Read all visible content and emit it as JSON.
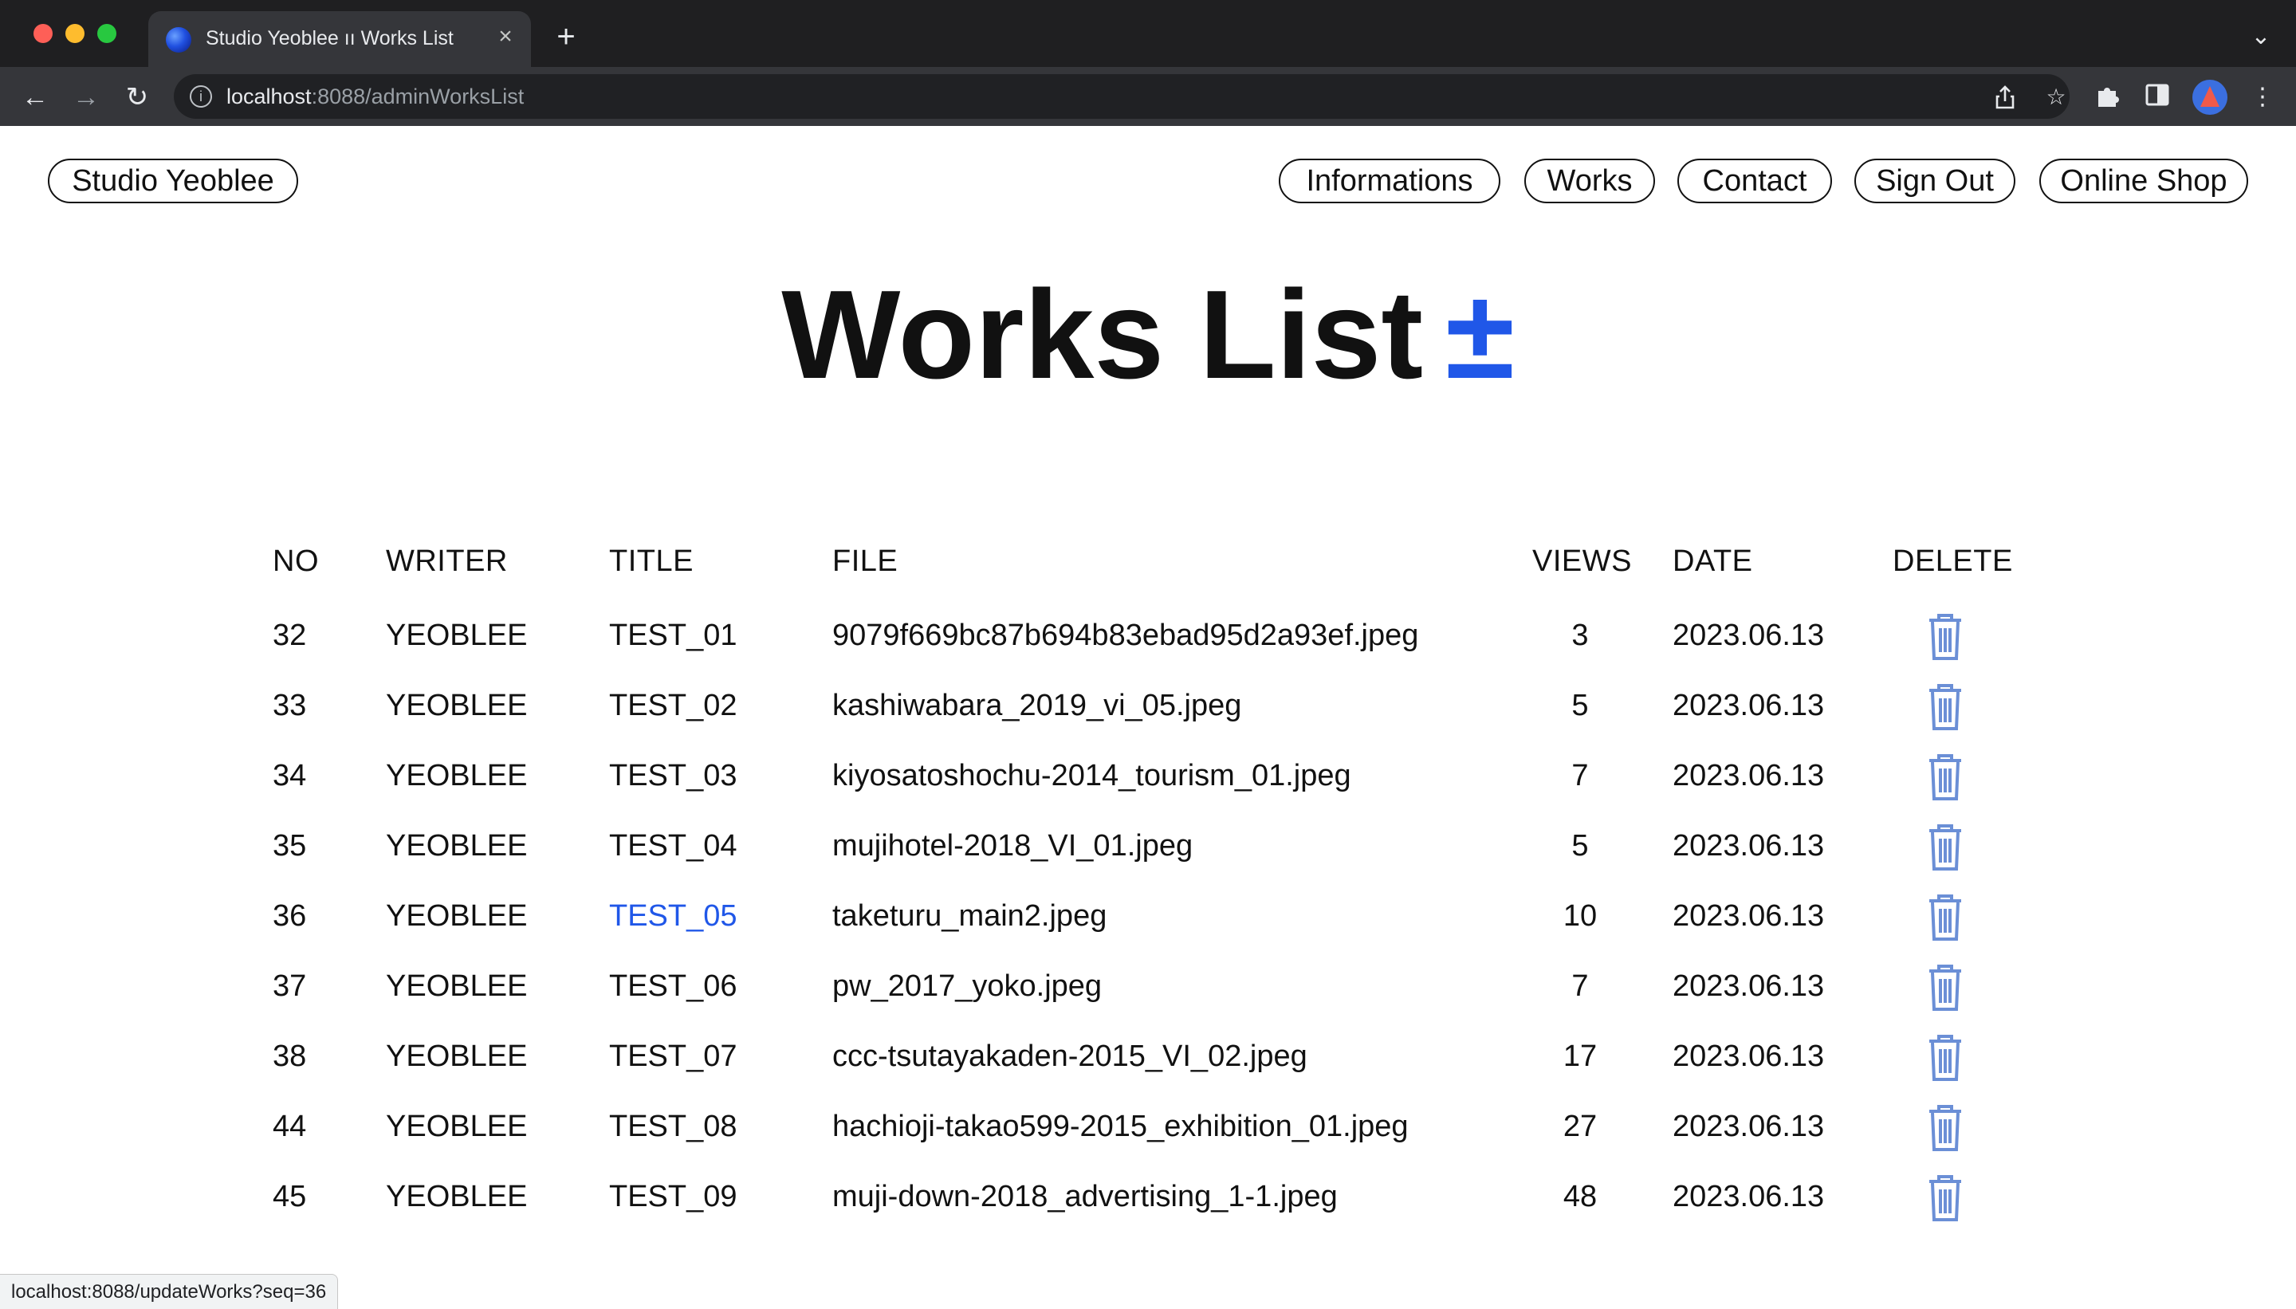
{
  "browser": {
    "tab_title": "Studio Yeoblee ıı Works List",
    "url_host": "localhost",
    "url_path": ":8088/adminWorksList",
    "status_url": "localhost:8088/updateWorks?seq=36"
  },
  "site": {
    "brand": "Studio Yeoblee",
    "nav": [
      "Informations",
      "Works",
      "Contact",
      "Sign Out",
      "Online Shop"
    ]
  },
  "page": {
    "title": "Works List",
    "add_symbol": "±"
  },
  "table": {
    "headers": [
      "NO",
      "WRITER",
      "TITLE",
      "FILE",
      "VIEWS",
      "DATE",
      "DELETE"
    ],
    "rows": [
      {
        "no": "32",
        "writer": "YEOBLEE",
        "title": "TEST_01",
        "file": "9079f669bc87b694b83ebad95d2a93ef.jpeg",
        "views": "3",
        "date": "2023.06.13"
      },
      {
        "no": "33",
        "writer": "YEOBLEE",
        "title": "TEST_02",
        "file": "kashiwabara_2019_vi_05.jpeg",
        "views": "5",
        "date": "2023.06.13"
      },
      {
        "no": "34",
        "writer": "YEOBLEE",
        "title": "TEST_03",
        "file": "kiyosatoshochu-2014_tourism_01.jpeg",
        "views": "7",
        "date": "2023.06.13"
      },
      {
        "no": "35",
        "writer": "YEOBLEE",
        "title": "TEST_04",
        "file": "mujihotel-2018_VI_01.jpeg",
        "views": "5",
        "date": "2023.06.13"
      },
      {
        "no": "36",
        "writer": "YEOBLEE",
        "title": "TEST_05",
        "file": "taketuru_main2.jpeg",
        "views": "10",
        "date": "2023.06.13"
      },
      {
        "no": "37",
        "writer": "YEOBLEE",
        "title": "TEST_06",
        "file": "pw_2017_yoko.jpeg",
        "views": "7",
        "date": "2023.06.13"
      },
      {
        "no": "38",
        "writer": "YEOBLEE",
        "title": "TEST_07",
        "file": "ccc-tsutayakaden-2015_VI_02.jpeg",
        "views": "17",
        "date": "2023.06.13"
      },
      {
        "no": "44",
        "writer": "YEOBLEE",
        "title": "TEST_08",
        "file": "hachioji-takao599-2015_exhibition_01.jpeg",
        "views": "27",
        "date": "2023.06.13"
      },
      {
        "no": "45",
        "writer": "YEOBLEE",
        "title": "TEST_09",
        "file": "muji-down-2018_advertising_1-1.jpeg",
        "views": "48",
        "date": "2023.06.13"
      }
    ]
  },
  "colors": {
    "accent_link": "#2057e8",
    "trash_icon": "#6b8fd6"
  }
}
